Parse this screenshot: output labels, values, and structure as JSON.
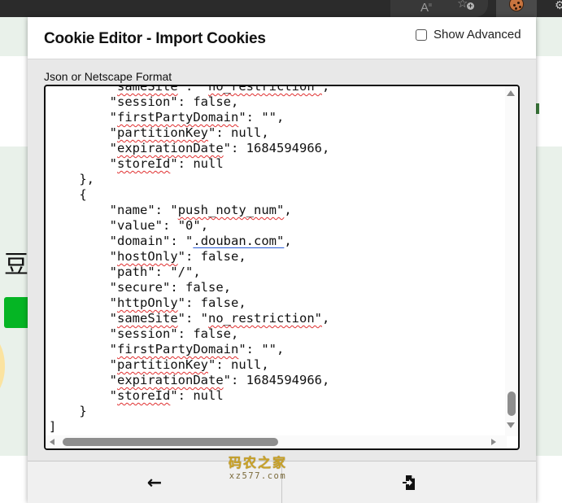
{
  "browser": {
    "toolbar_icons": [
      "reader-mode-icon",
      "add-favorite-icon",
      "cookie-editor-extension-icon",
      "extensions-icon"
    ]
  },
  "background_page": {
    "visible_glyph": "豆"
  },
  "popup": {
    "title": "Cookie Editor - Import Cookies",
    "show_advanced": {
      "label": "Show Advanced",
      "checked": false
    },
    "field_label": "Json or Netscape Format",
    "editor_lines": [
      {
        "indent": 8,
        "key": "sameSite",
        "value": "\"no_restriction\"",
        "comma": true,
        "partial": true
      },
      {
        "indent": 8,
        "key": "session",
        "value": "false",
        "comma": true
      },
      {
        "indent": 8,
        "key": "firstPartyDomain",
        "value": "\"\"",
        "comma": true
      },
      {
        "indent": 8,
        "key": "partitionKey",
        "value": "null",
        "comma": true
      },
      {
        "indent": 8,
        "key": "expirationDate",
        "value": "1684594966",
        "comma": true
      },
      {
        "indent": 8,
        "key": "storeId",
        "value": "null",
        "comma": false
      },
      {
        "indent": 4,
        "raw": "},"
      },
      {
        "indent": 4,
        "raw": "{"
      },
      {
        "indent": 8,
        "key": "name",
        "value": "\"push_noty_num\"",
        "comma": true
      },
      {
        "indent": 8,
        "key": "value",
        "value": "\"0\"",
        "comma": true
      },
      {
        "indent": 8,
        "key": "domain",
        "value": "\".douban.com\"",
        "comma": true
      },
      {
        "indent": 8,
        "key": "hostOnly",
        "value": "false",
        "comma": true
      },
      {
        "indent": 8,
        "key": "path",
        "value": "\"/\"",
        "comma": true
      },
      {
        "indent": 8,
        "key": "secure",
        "value": "false",
        "comma": true
      },
      {
        "indent": 8,
        "key": "httpOnly",
        "value": "false",
        "comma": true
      },
      {
        "indent": 8,
        "key": "sameSite",
        "value": "\"no_restriction\"",
        "comma": true
      },
      {
        "indent": 8,
        "key": "session",
        "value": "false",
        "comma": true
      },
      {
        "indent": 8,
        "key": "firstPartyDomain",
        "value": "\"\"",
        "comma": true
      },
      {
        "indent": 8,
        "key": "partitionKey",
        "value": "null",
        "comma": true
      },
      {
        "indent": 8,
        "key": "expirationDate",
        "value": "1684594966",
        "comma": true
      },
      {
        "indent": 8,
        "key": "storeId",
        "value": "null",
        "comma": false
      },
      {
        "indent": 4,
        "raw": "}"
      },
      {
        "indent": 0,
        "raw": "]"
      }
    ],
    "spellcheck_flagged_keys": [
      "firstPartyDomain",
      "partitionKey",
      "expirationDate",
      "storeId",
      "hostOnly",
      "httpOnly",
      "sameSite"
    ],
    "spellcheck_flagged_values": [
      "\"push_noty_num\"",
      "\"no_restriction\""
    ],
    "link_values": [
      "\".douban.com\""
    ],
    "scroll": {
      "vertical_position": 0.95,
      "horizontal_position": 0.0
    },
    "footer": {
      "back_button": {
        "icon": "arrow-left-icon",
        "glyph": "←"
      },
      "import_button": {
        "icon": "file-import-icon"
      }
    }
  },
  "watermark": {
    "cn": "码农之家",
    "en": "xz577.com"
  }
}
